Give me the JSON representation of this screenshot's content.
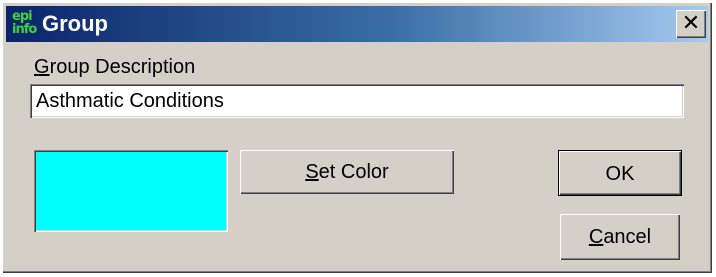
{
  "window": {
    "title": "Group",
    "app_icon_text": "epi info",
    "close_label": "✕"
  },
  "form": {
    "description_label_accesskey": "G",
    "description_label_rest": "roup Description",
    "description_value": "Asthmatic Conditions",
    "swatch_color": "#00ffff"
  },
  "buttons": {
    "set_color_accesskey": "S",
    "set_color_rest": "et Color",
    "ok_label": "OK",
    "cancel_accesskey": "C",
    "cancel_rest": "ancel"
  }
}
